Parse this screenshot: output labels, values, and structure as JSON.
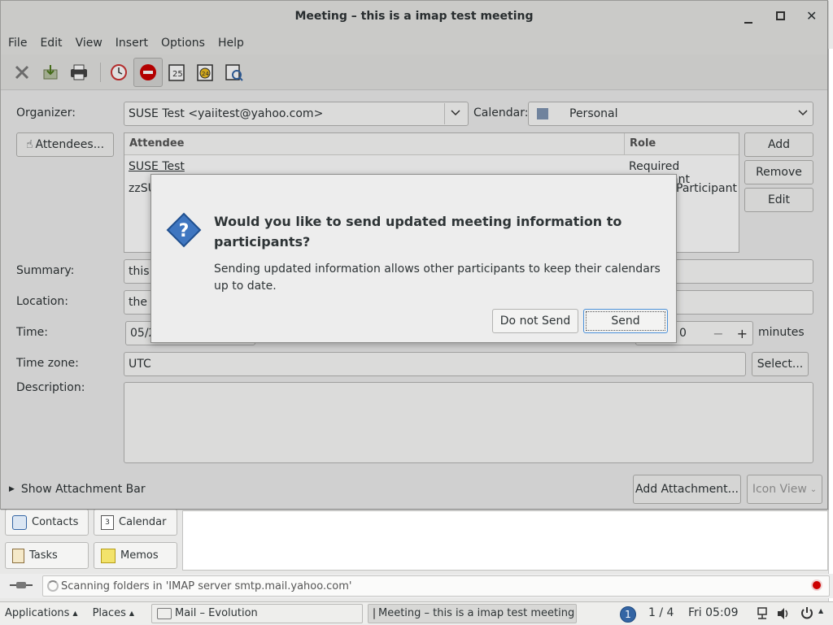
{
  "window": {
    "title": "Meeting – this is a imap test meeting"
  },
  "menu": [
    "File",
    "Edit",
    "View",
    "Insert",
    "Options",
    "Help"
  ],
  "form": {
    "organizer_label": "Organizer:",
    "organizer_value": "SUSE Test <yaiitest@yahoo.com>",
    "calendar_label": "Calendar:",
    "calendar_value": "Personal",
    "attendees_button": "Attendees...",
    "col_attendee": "Attendee",
    "col_role": "Role",
    "attendees": [
      {
        "name": "SUSE Test",
        "role": "Required Participant"
      },
      {
        "name": "zzSU",
        "role": "Participant"
      }
    ],
    "add_button": "Add",
    "remove_button": "Remove",
    "edit_button": "Edit",
    "summary_label": "Summary:",
    "summary_value": "this",
    "location_label": "Location:",
    "location_value": "the l",
    "time_label": "Time:",
    "time_value": "05/2",
    "minutes_value": "0",
    "minutes_label": "minutes",
    "timezone_label": "Time zone:",
    "timezone_value": "UTC",
    "timezone_select": "Select...",
    "description_label": "Description:",
    "show_attachment_bar": "Show Attachment Bar",
    "add_attachment": "Add Attachment...",
    "icon_view": "Icon View"
  },
  "dialog": {
    "title": "Would you like to send updated meeting information to participants?",
    "body": "Sending updated information allows other participants to keep their calendars up to date.",
    "do_not_send": "Do not Send",
    "send": "Send"
  },
  "switcher": {
    "contacts": "Contacts",
    "calendar": "Calendar",
    "tasks": "Tasks",
    "memos": "Memos"
  },
  "status": {
    "text": "Scanning folders in 'IMAP server smtp.mail.yahoo.com'"
  },
  "taskbar": {
    "applications": "Applications",
    "places": "Places",
    "task1": "Mail – Evolution",
    "task2": "Meeting – this is a imap test meeting",
    "workspace_badge": "1",
    "workspace": "1 / 4",
    "clock": "Fri 05:09"
  },
  "colors": {
    "accent": "#3465a4",
    "stop_red": "#cc0000"
  }
}
